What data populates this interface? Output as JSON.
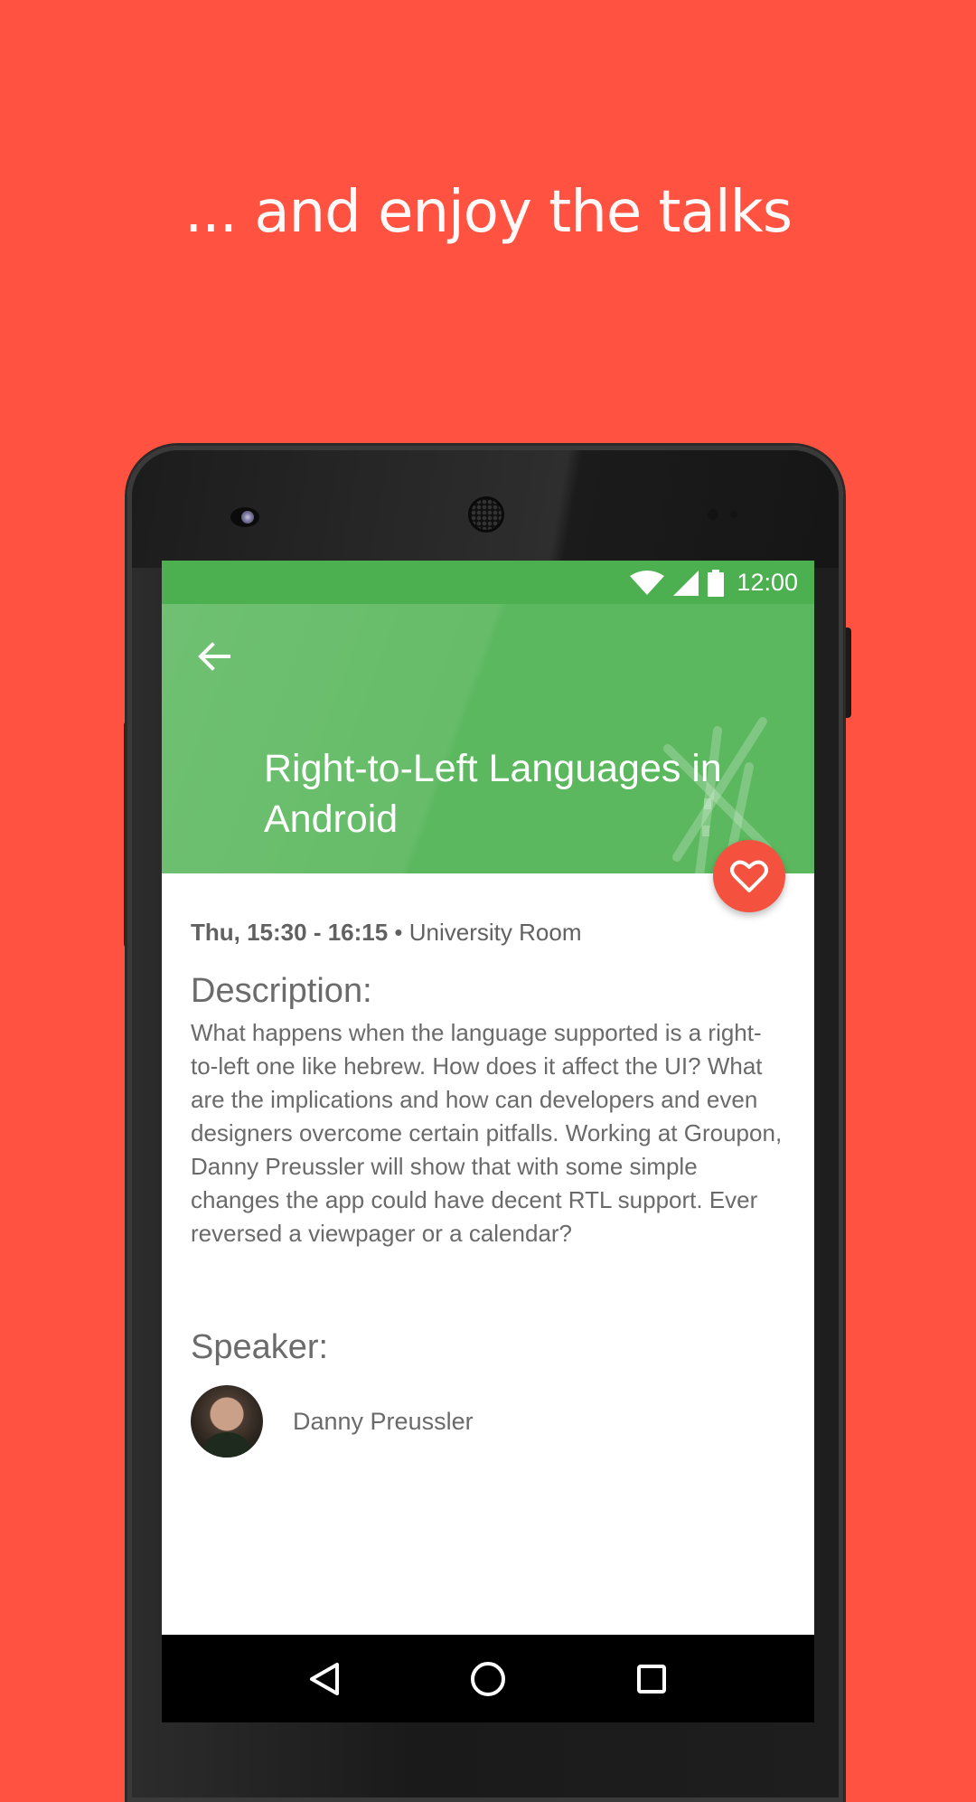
{
  "promo": {
    "headline": "... and enjoy the talks",
    "background_color": "#FF5240"
  },
  "status_bar": {
    "time": "12:00",
    "icons": [
      "wifi-icon",
      "cellular-signal-icon",
      "battery-icon"
    ],
    "color": "#4caf50"
  },
  "app_bar": {
    "back_icon": "arrow-back-icon",
    "title": "Right-to-Left Languages in Android",
    "color": "#5cb85f",
    "favorite_icon": "heart-outline-icon",
    "favorite_color": "#f4523f"
  },
  "talk": {
    "time": "Thu, 15:30 - 16:15",
    "separator": " • ",
    "room": "University Room",
    "description_heading": "Description:",
    "description": "What happens when the language supported is a right-to-left one like hebrew. How does it affect the UI? What are the implications and how can developers and even designers overcome certain pitfalls. Working at Groupon, Danny Preussler will show that with some simple changes the app could have decent RTL support. Ever reversed a viewpager or a calendar?",
    "speaker_heading": "Speaker:",
    "speakers": [
      {
        "name": "Danny Preussler"
      }
    ]
  },
  "nav_bar": {
    "buttons": [
      "back-triangle-icon",
      "home-circle-icon",
      "recents-square-icon"
    ]
  }
}
